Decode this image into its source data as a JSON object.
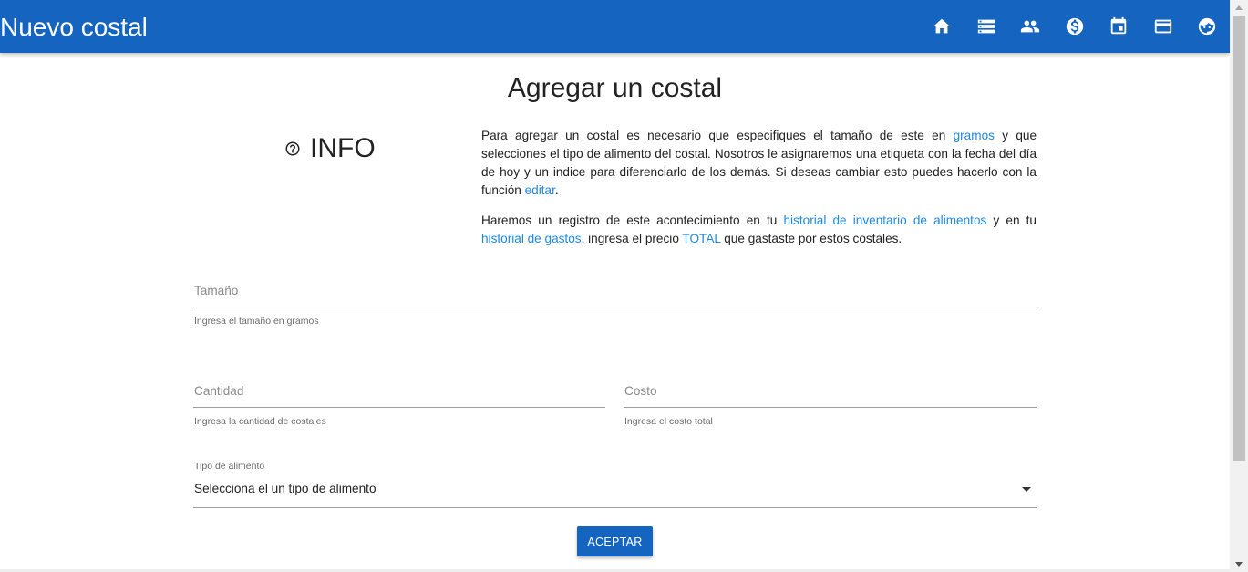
{
  "app": {
    "title": "Nuevo costal",
    "accent_color": "#1565c0",
    "nav_icons": [
      "home-icon",
      "inventory-list-icon",
      "people-icon",
      "money-icon",
      "calendar-icon",
      "card-icon",
      "baby-face-icon"
    ]
  },
  "main": {
    "title": "Agregar un costal",
    "info": {
      "heading": "INFO",
      "p1": {
        "t1": "Para agregar un costal es necesario que especifiques el tamaño de este en ",
        "link1": "gramos",
        "t2": " y que selecciones el tipo de alimento del costal. Nosotros le asignaremos una etiqueta con la fecha del día de hoy y un indice para diferenciarlo de los demás. Si deseas cambiar esto puedes hacerlo con la función ",
        "link2": "editar",
        "t3": "."
      },
      "p2": {
        "t1": "Haremos un registro de este acontecimiento en tu ",
        "link1": "historial de inventario de alimentos",
        "t2": " y en tu ",
        "link2": "historial de gastos",
        "t3": ", ingresa el precio ",
        "link3": "TOTAL",
        "t4": " que gastaste por estos costales."
      }
    },
    "form": {
      "size": {
        "placeholder": "Tamaño",
        "helper": "Ingresa el tamaño en gramos"
      },
      "quantity": {
        "placeholder": "Cantidad",
        "helper": "Ingresa la cantidad de costales"
      },
      "cost": {
        "placeholder": "Costo",
        "helper": "Ingresa el costo total"
      },
      "food_type": {
        "label": "Tipo de alimento",
        "selected": "Selecciona el un tipo de alimento"
      },
      "submit_label": "ACEPTAR"
    }
  }
}
